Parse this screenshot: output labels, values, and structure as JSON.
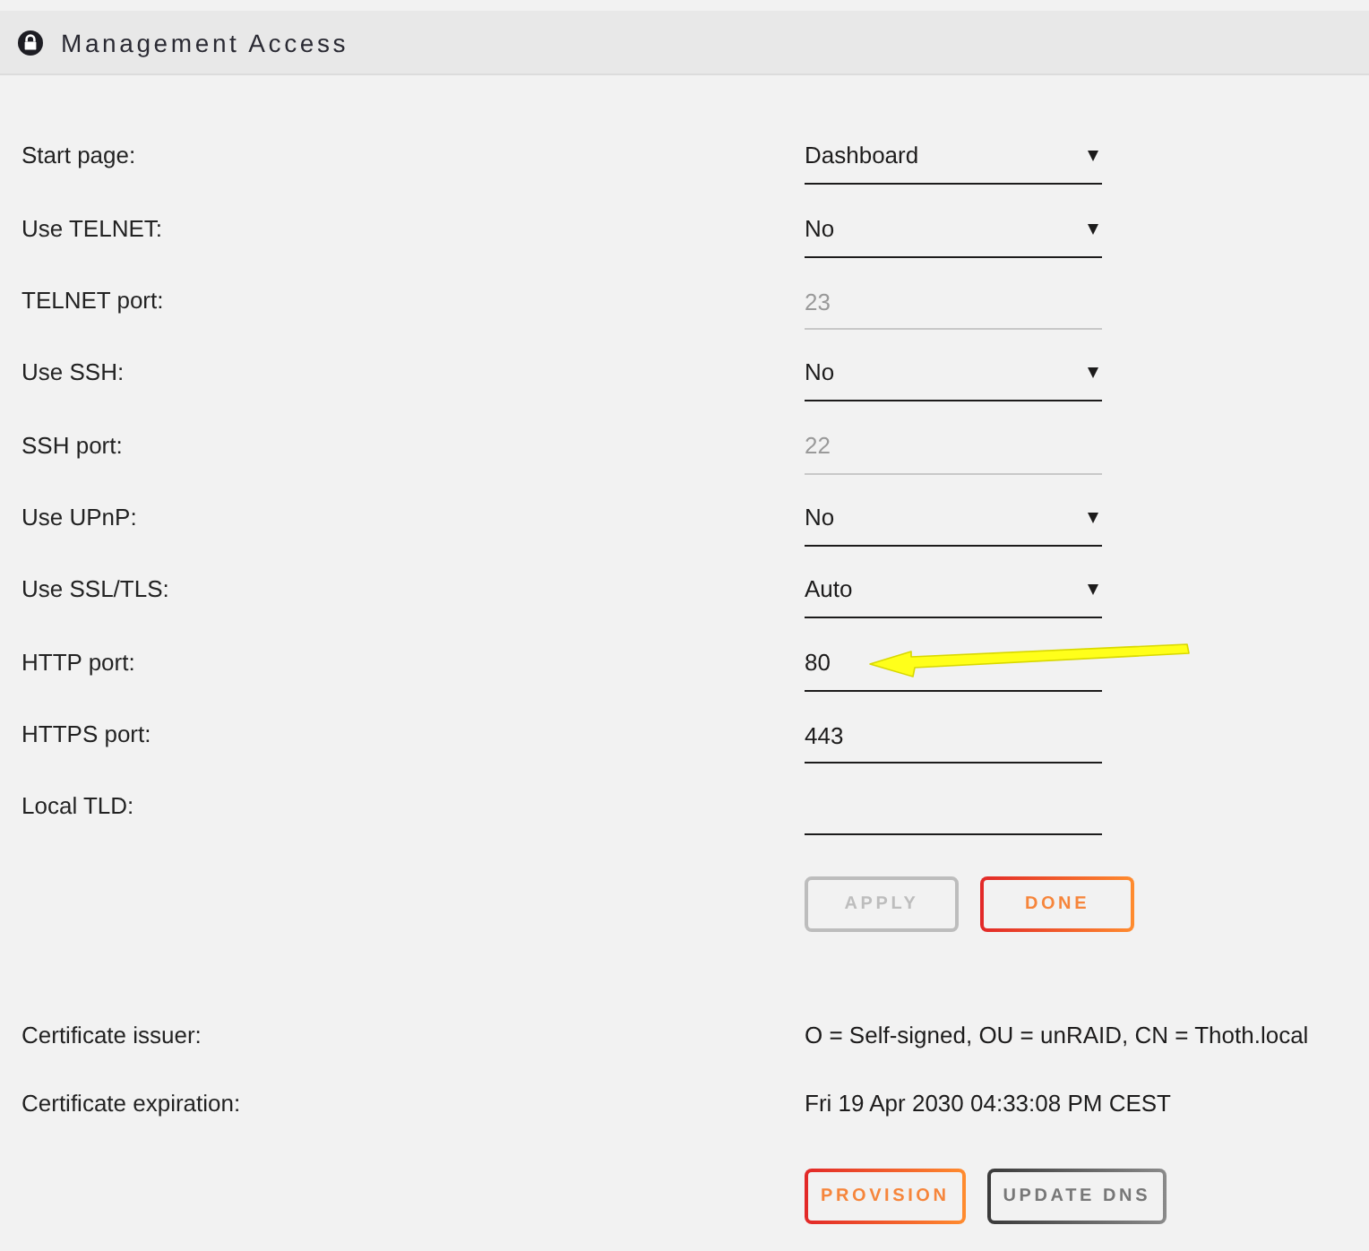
{
  "section": {
    "title": "Management Access"
  },
  "settings": [
    {
      "label": "Start page:",
      "kind": "select",
      "value": "Dashboard",
      "disabled": false
    },
    {
      "label": "Use TELNET:",
      "kind": "select",
      "value": "No",
      "disabled": false
    },
    {
      "label": "TELNET port:",
      "kind": "input",
      "value": "23",
      "disabled": true
    },
    {
      "label": "Use SSH:",
      "kind": "select",
      "value": "No",
      "disabled": false
    },
    {
      "label": "SSH port:",
      "kind": "input",
      "value": "22",
      "disabled": true
    },
    {
      "label": "Use UPnP:",
      "kind": "select",
      "value": "No",
      "disabled": false
    },
    {
      "label": "Use SSL/TLS:",
      "kind": "select",
      "value": "Auto",
      "disabled": false
    },
    {
      "label": "HTTP port:",
      "kind": "input",
      "value": "80",
      "disabled": false
    },
    {
      "label": "HTTPS port:",
      "kind": "input",
      "value": "443",
      "disabled": false
    },
    {
      "label": "Local TLD:",
      "kind": "input",
      "disabled": false
    }
  ],
  "form_buttons": [
    {
      "label": "APPLY",
      "kind": "accent",
      "disabled": true
    },
    {
      "label": "DONE",
      "kind": "accent",
      "disabled": false
    }
  ],
  "certificate": [
    {
      "label": "Certificate issuer:",
      "value": "O = Self-signed, OU = unRAID, CN = Thoth.local"
    },
    {
      "label": "Certificate expiration:",
      "value": "Fri 19 Apr 2030 04:33:08 PM CEST"
    }
  ],
  "certificate_buttons": [
    {
      "label": "PROVISION",
      "kind": "accent",
      "disabled": false
    },
    {
      "label": "UPDATE DNS",
      "kind": "dark",
      "disabled": false
    }
  ]
}
